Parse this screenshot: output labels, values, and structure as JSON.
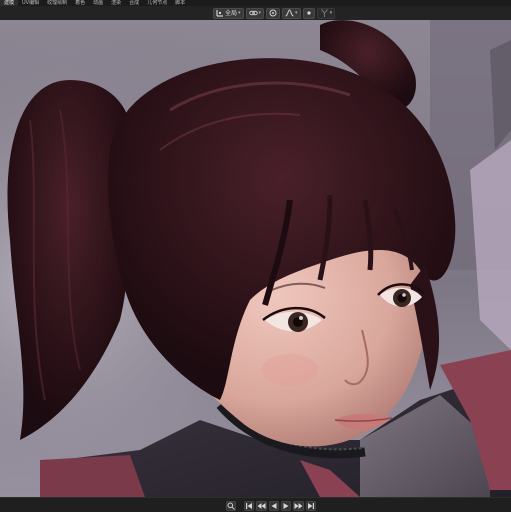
{
  "workspace_tabs": [
    "建模",
    "UV编辑",
    "纹理绘制",
    "着色",
    "动画",
    "渲染",
    "合成",
    "几何节点",
    "脚本"
  ],
  "viewport_header": {
    "transform_pivot_icon": "transform-pivot-icon",
    "orientation_label": "全局",
    "snap_icon": "snap-link-icon",
    "proportional_icon": "proportional-edit-icon",
    "falloff_icon": "falloff-curve-icon",
    "overlay_icon": "dot-icon",
    "disabled_icon": "fork-icon"
  },
  "playback": {
    "icons": [
      "search-icon",
      "jump-start-icon",
      "prev-keyframe-icon",
      "play-reverse-icon",
      "play-icon",
      "next-keyframe-icon",
      "jump-end-icon"
    ]
  }
}
